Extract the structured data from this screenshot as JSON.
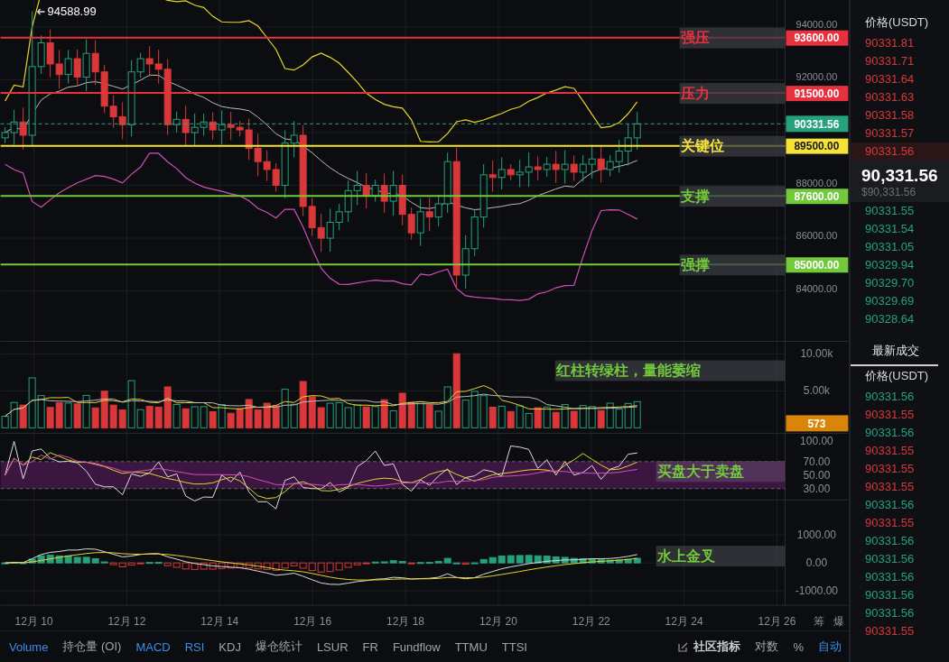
{
  "price_chart": {
    "high_marker": "94588.99",
    "y_ticks": [
      "94000.00",
      "92000.00",
      "88000.00",
      "86000.00",
      "84000.00"
    ],
    "levels": [
      {
        "label": "强压",
        "price": "93600.00",
        "color": "#e8313f"
      },
      {
        "label": "压力",
        "price": "91500.00",
        "color": "#e8313f"
      },
      {
        "label": "关键位",
        "price": "89500.00",
        "color": "#f5e33a"
      },
      {
        "label": "支撑",
        "price": "87600.00",
        "color": "#72c93c"
      },
      {
        "label": "强撑",
        "price": "85000.00",
        "color": "#72c93c"
      }
    ],
    "last_price": "90331.56"
  },
  "volume_panel": {
    "y_ticks": [
      "10.00k",
      "5.00k"
    ],
    "note": "红柱转绿柱，量能萎缩",
    "current": "573"
  },
  "rsi_panel": {
    "y_ticks": [
      "100.00",
      "70.00",
      "50.00",
      "30.00"
    ],
    "note": "买盘大于卖盘"
  },
  "macd_panel": {
    "y_ticks": [
      "1000.00",
      "0.00",
      "-1000.00"
    ],
    "note": "水上金叉"
  },
  "x_axis": {
    "labels": [
      "12月 10",
      "12月 12",
      "12月 14",
      "12月 16",
      "12月 18",
      "12月 20",
      "12月 22",
      "12月 24",
      "12月 26"
    ],
    "tools": [
      "筹",
      "爆"
    ]
  },
  "indicator_tabs": [
    {
      "label": "Volume",
      "selected": true
    },
    {
      "label": "持仓量 (OI)",
      "selected": false
    },
    {
      "label": "MACD",
      "selected": true
    },
    {
      "label": "RSI",
      "selected": true
    },
    {
      "label": "KDJ",
      "selected": false
    },
    {
      "label": "爆仓统计",
      "selected": false
    },
    {
      "label": "LSUR",
      "selected": false
    },
    {
      "label": "FR",
      "selected": false
    },
    {
      "label": "Fundflow",
      "selected": false
    },
    {
      "label": "TTMU",
      "selected": false
    },
    {
      "label": "TTSI",
      "selected": false
    }
  ],
  "toolbar_right": {
    "community": "社区指标",
    "options": [
      {
        "label": "对数",
        "selected": false
      },
      {
        "label": "%",
        "selected": false
      },
      {
        "label": "自动",
        "selected": true
      }
    ]
  },
  "order_book": {
    "column": "价格(USDT)",
    "asks": [
      "90331.81",
      "90331.71",
      "90331.64",
      "90331.63",
      "90331.58",
      "90331.57",
      "90331.56"
    ],
    "mid_price": "90,331.56",
    "mid_usd": "$90,331.56",
    "bids": [
      "90331.55",
      "90331.54",
      "90331.05",
      "90329.94",
      "90329.70",
      "90329.69",
      "90328.64"
    ]
  },
  "trades": {
    "title": "最新成交",
    "column": "价格(USDT)",
    "rows": [
      {
        "price": "90331.56",
        "color": "#26a17b"
      },
      {
        "price": "90331.55",
        "color": "#d9383a"
      },
      {
        "price": "90331.56",
        "color": "#26a17b"
      },
      {
        "price": "90331.55",
        "color": "#d9383a"
      },
      {
        "price": "90331.55",
        "color": "#d9383a"
      },
      {
        "price": "90331.55",
        "color": "#d9383a"
      },
      {
        "price": "90331.56",
        "color": "#26a17b"
      },
      {
        "price": "90331.55",
        "color": "#d9383a"
      },
      {
        "price": "90331.56",
        "color": "#26a17b"
      },
      {
        "price": "90331.56",
        "color": "#26a17b"
      },
      {
        "price": "90331.56",
        "color": "#26a17b"
      },
      {
        "price": "90331.56",
        "color": "#26a17b"
      },
      {
        "price": "90331.56",
        "color": "#26a17b"
      },
      {
        "price": "90331.55",
        "color": "#d9383a"
      }
    ]
  }
}
